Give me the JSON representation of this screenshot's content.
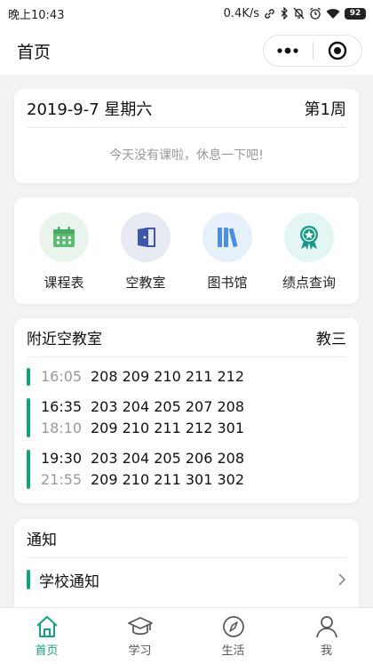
{
  "status_bar": {
    "time": "晚上10:43",
    "net_speed": "0.4K/s",
    "battery": "92"
  },
  "nav": {
    "title": "首页"
  },
  "today": {
    "date": "2019-9-7 星期六",
    "week": "第1周",
    "message": "今天没有课啦，休息一下吧!"
  },
  "menu": [
    {
      "label": "课程表",
      "icon": "calendar-icon",
      "bg": "#e9f5ec",
      "color": "#5dbb73"
    },
    {
      "label": "空教室",
      "icon": "door-icon",
      "bg": "#e8eaf3",
      "color": "#3f57a8"
    },
    {
      "label": "图书馆",
      "icon": "books-icon",
      "bg": "#e6f0fb",
      "color": "#4a8fe0"
    },
    {
      "label": "绩点查询",
      "icon": "medal-icon",
      "bg": "#e3f6f4",
      "color": "#189a8a"
    }
  ],
  "rooms": {
    "title": "附近空教室",
    "building": "教三",
    "slots": [
      [
        {
          "time": "16:05",
          "rooms": "208 209 210 211 212"
        }
      ],
      [
        {
          "time": "16:35",
          "rooms": "203 204 205 207 208"
        },
        {
          "time": "18:10",
          "rooms": "209 210 211 212 301"
        }
      ],
      [
        {
          "time": "19:30",
          "rooms": "203 204 205 206 208"
        },
        {
          "time": "21:55",
          "rooms": "209 210 211 301 302"
        }
      ]
    ]
  },
  "notice": {
    "title": "通知",
    "item": "学校通知"
  },
  "tabs": [
    {
      "label": "首页",
      "icon": "home-icon",
      "active": true
    },
    {
      "label": "学习",
      "icon": "graduation-cap-icon",
      "active": false
    },
    {
      "label": "生活",
      "icon": "compass-icon",
      "active": false
    },
    {
      "label": "我",
      "icon": "user-icon",
      "active": false
    }
  ],
  "colors": {
    "accent": "#13a37c",
    "background": "#f3f3f3"
  }
}
